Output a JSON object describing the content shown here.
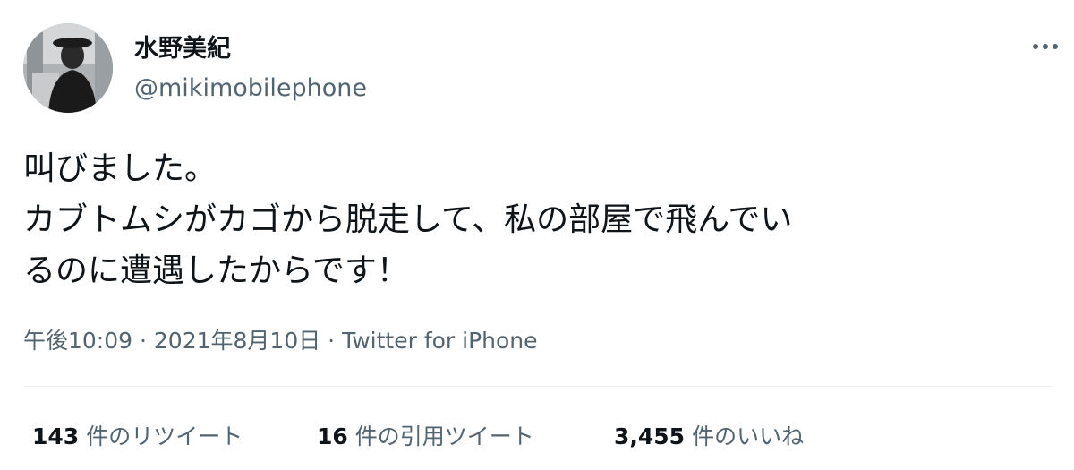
{
  "user": {
    "display_name": "水野美紀",
    "handle": "@mikimobilephone"
  },
  "tweet": {
    "lines": [
      "叫びました。",
      "カブトムシがカゴから脱走して、私の部屋で飛んでい",
      "るのに遭遇したからです！"
    ],
    "time": "午後10:09",
    "separator": " · ",
    "date": "2021年8月10日",
    "source": "Twitter for iPhone"
  },
  "stats": {
    "retweets": {
      "count": "143",
      "label": "件のリツイート"
    },
    "quotes": {
      "count": "16",
      "label": "件の引用ツイート"
    },
    "likes": {
      "count": "3,455",
      "label": "件のいいね"
    }
  },
  "icons": {
    "more": "more-horizontal-icon"
  },
  "colors": {
    "text_primary": "#0f1419",
    "text_secondary": "#536471",
    "divider": "#eff3f4",
    "background": "#ffffff"
  }
}
